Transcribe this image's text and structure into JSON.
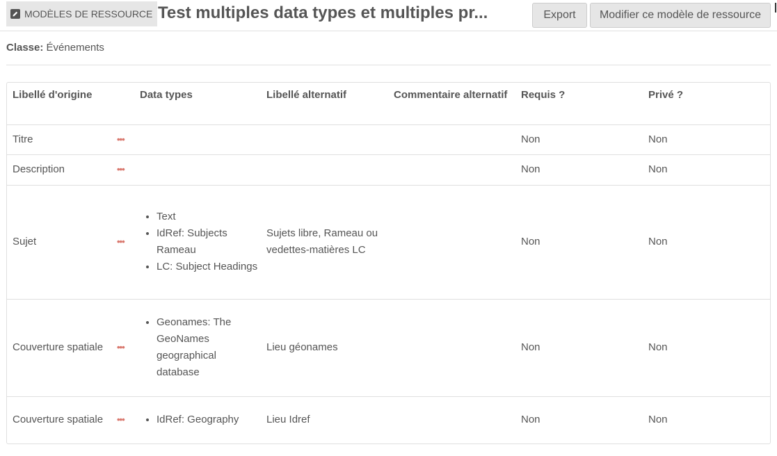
{
  "header": {
    "section_label": "MODÈLES DE RESSOURCE",
    "title": "Test multiples data types et multiples pr...",
    "export_label": "Export",
    "edit_label": "Modifier ce modèle de ressource"
  },
  "meta": {
    "class_label": "Classe:",
    "class_value": "Événements"
  },
  "table": {
    "headers": [
      "Libellé d'origine",
      "Data types",
      "Libellé alternatif",
      "Commentaire alternatif",
      "Requis ?",
      "Privé ?"
    ],
    "rows": [
      {
        "label": "Titre",
        "data_types": [],
        "alt_label": "",
        "alt_comment": "",
        "required": "Non",
        "private": "Non"
      },
      {
        "label": "Description",
        "data_types": [],
        "alt_label": "",
        "alt_comment": "",
        "required": "Non",
        "private": "Non"
      },
      {
        "label": "Sujet",
        "data_types": [
          "Text",
          "IdRef: Subjects Rameau",
          "LC: Subject Headings"
        ],
        "alt_label": "Sujets libre, Rameau ou vedettes-matières LC",
        "alt_comment": "",
        "required": "Non",
        "private": "Non"
      },
      {
        "label": "Couverture spatiale",
        "data_types": [
          "Geonames: The GeoNames geographical database"
        ],
        "alt_label": "Lieu géonames",
        "alt_comment": "",
        "required": "Non",
        "private": "Non"
      },
      {
        "label": "Couverture spatiale",
        "data_types": [
          "IdRef: Geography"
        ],
        "alt_label": "Lieu Idref",
        "alt_comment": "",
        "required": "Non",
        "private": "Non"
      }
    ],
    "row_menu_glyph": "•••"
  }
}
